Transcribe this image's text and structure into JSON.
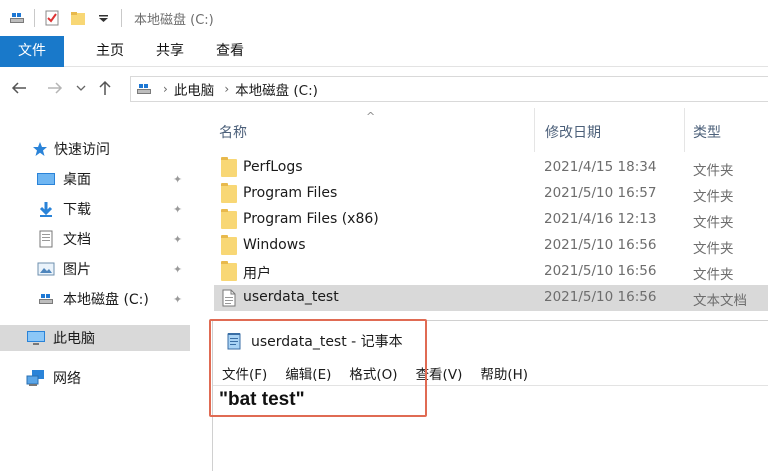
{
  "window": {
    "title": "本地磁盘 (C:)"
  },
  "ribbon": {
    "tabs": [
      {
        "label": "文件"
      },
      {
        "label": "主页"
      },
      {
        "label": "共享"
      },
      {
        "label": "查看"
      }
    ]
  },
  "address": {
    "crumbs": [
      "此电脑",
      "本地磁盘 (C:)"
    ]
  },
  "sidebar": {
    "quick_access": "快速访问",
    "items": [
      {
        "label": "桌面"
      },
      {
        "label": "下载"
      },
      {
        "label": "文档"
      },
      {
        "label": "图片"
      },
      {
        "label": "本地磁盘 (C:)"
      }
    ],
    "this_pc": "此电脑",
    "network": "网络"
  },
  "columns": {
    "name": "名称",
    "modified": "修改日期",
    "type": "类型"
  },
  "files": [
    {
      "name": "PerfLogs",
      "date": "2021/4/15 18:34",
      "type": "文件夹"
    },
    {
      "name": "Program Files",
      "date": "2021/5/10 16:57",
      "type": "文件夹"
    },
    {
      "name": "Program Files (x86)",
      "date": "2021/4/16 12:13",
      "type": "文件夹"
    },
    {
      "name": "Windows",
      "date": "2021/5/10 16:56",
      "type": "文件夹"
    },
    {
      "name": "用户",
      "date": "2021/5/10 16:56",
      "type": "文件夹"
    },
    {
      "name": "userdata_test",
      "date": "2021/5/10 16:56",
      "type": "文本文档"
    }
  ],
  "notepad": {
    "title": "userdata_test - 记事本",
    "menu": [
      "文件(F)",
      "编辑(E)",
      "格式(O)",
      "查看(V)",
      "帮助(H)"
    ],
    "content": "\"bat test\""
  },
  "colors": {
    "accent": "#1979ca",
    "folder": "#f8d775",
    "highlight": "#e06b53"
  }
}
